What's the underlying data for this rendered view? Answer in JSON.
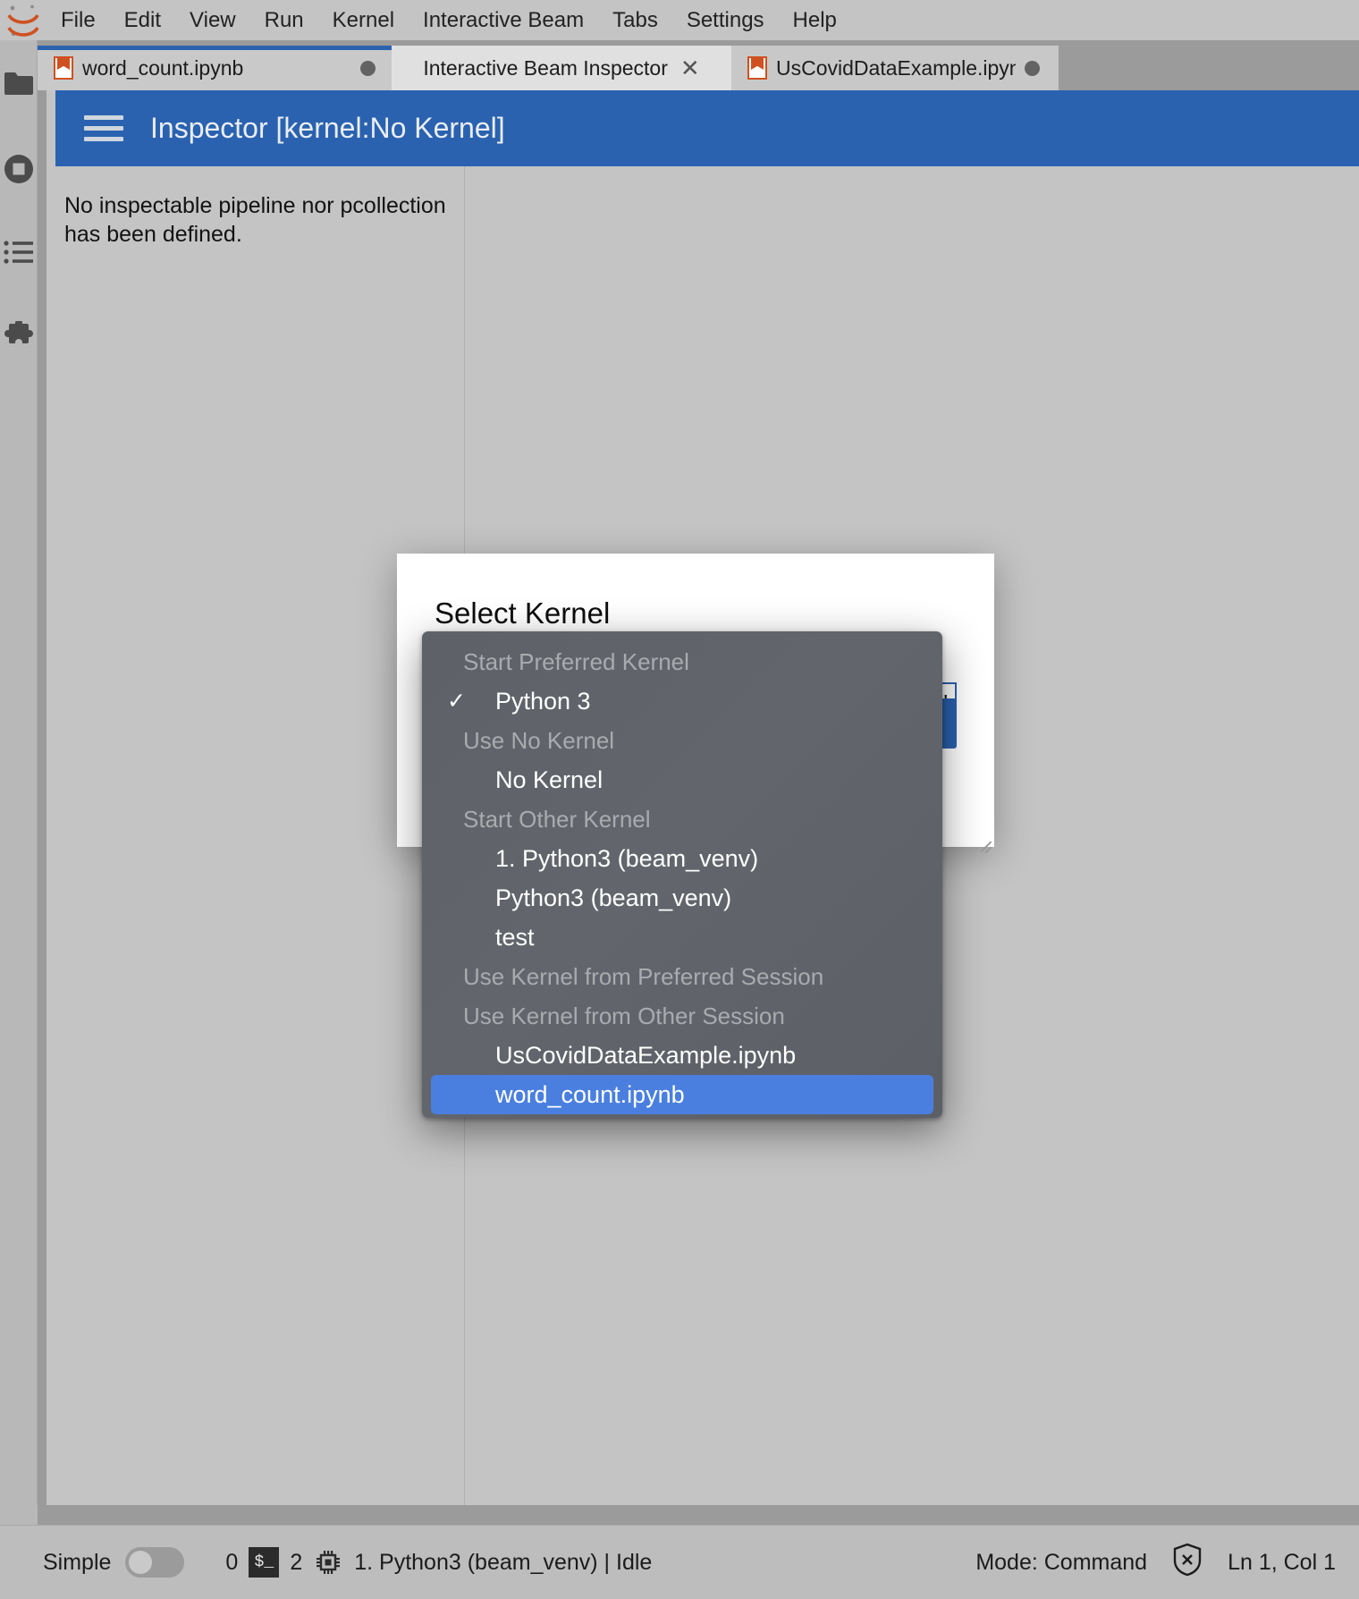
{
  "app": {
    "logo_name": "jupyter-logo"
  },
  "menubar": {
    "items": [
      {
        "label": "File"
      },
      {
        "label": "Edit"
      },
      {
        "label": "View"
      },
      {
        "label": "Run"
      },
      {
        "label": "Kernel"
      },
      {
        "label": "Interactive Beam"
      },
      {
        "label": "Tabs"
      },
      {
        "label": "Settings"
      },
      {
        "label": "Help"
      }
    ]
  },
  "activitybar": {
    "items": [
      {
        "icon": "folder-icon",
        "name": "file-browser"
      },
      {
        "icon": "stop-circle-icon",
        "name": "running-sessions"
      },
      {
        "icon": "list-icon",
        "name": "command-palette"
      },
      {
        "icon": "puzzle-icon",
        "name": "extension-manager"
      }
    ]
  },
  "tabs": [
    {
      "label": "word_count.ipynb",
      "state": "active",
      "modified_dot": true,
      "closable": false
    },
    {
      "label": "Interactive Beam Inspector",
      "state": "current",
      "modified_dot": false,
      "closable": true,
      "close_glyph": "✕"
    },
    {
      "label": "UsCovidDataExample.ipynb",
      "state": "inactive",
      "modified_dot": true,
      "closable": false
    }
  ],
  "inspector": {
    "title": "Inspector [kernel:No Kernel]",
    "menu_icon": "hamburger-icon",
    "message": "No inspectable pipeline nor pcollection has been defined."
  },
  "dialog": {
    "title": "Select Kernel",
    "field_quote": "\"",
    "accent_color": "#2a62b0"
  },
  "dropdown": {
    "groups": [
      {
        "header": "Start Preferred Kernel",
        "items": [
          {
            "label": "Python 3",
            "checked": true,
            "selected": false
          }
        ]
      },
      {
        "header": "Use No Kernel",
        "items": [
          {
            "label": "No Kernel",
            "checked": false,
            "selected": false
          }
        ]
      },
      {
        "header": "Start Other Kernel",
        "items": [
          {
            "label": "1. Python3 (beam_venv)",
            "checked": false,
            "selected": false
          },
          {
            "label": "Python3 (beam_venv)",
            "checked": false,
            "selected": false
          },
          {
            "label": "test",
            "checked": false,
            "selected": false
          }
        ]
      },
      {
        "header": "Use Kernel from Preferred Session",
        "items": []
      },
      {
        "header": "Use Kernel from Other Session",
        "items": [
          {
            "label": "UsCovidDataExample.ipynb",
            "checked": false,
            "selected": false
          },
          {
            "label": "word_count.ipynb",
            "checked": false,
            "selected": true
          }
        ]
      }
    ],
    "check_glyph": "✓",
    "highlight_color": "#4a7fe0"
  },
  "statusbar": {
    "simple_label": "Simple",
    "simple_toggle_on": false,
    "kernel_count": "0",
    "terminal_glyph": "$_",
    "terminal_count": "2",
    "cpu_icon": "chip-icon",
    "kernel_status": "1. Python3 (beam_venv) | Idle",
    "mode": "Mode: Command",
    "trust_icon": "untrusted-shield-icon",
    "cursor_position": "Ln 1, Col 1"
  }
}
